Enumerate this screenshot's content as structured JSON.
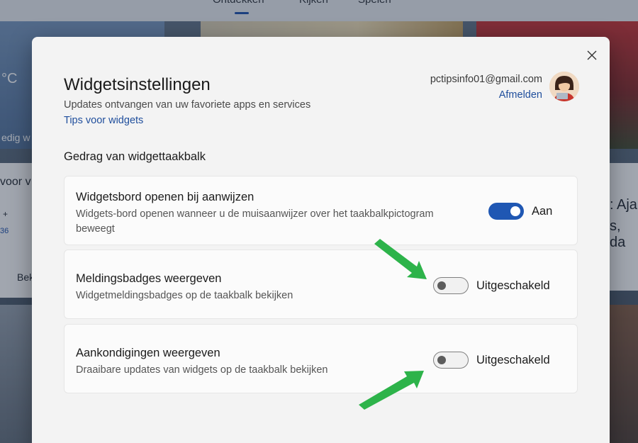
{
  "background": {
    "tabs": [
      "Ontdekken",
      "Kijken",
      "Spelen"
    ],
    "fragments": {
      "temp": "°C",
      "weather_hint": "edig w",
      "left_heading": "voor v",
      "left_row_1": "+",
      "left_row_2": "36",
      "left_button": "Bek",
      "right_headline_1": ": Aja",
      "right_headline_2": "s, da"
    }
  },
  "dialog": {
    "title": "Widgetsinstellingen",
    "subtitle": "Updates ontvangen van uw favoriete apps en services",
    "tips_link": "Tips voor widgets",
    "account": {
      "email": "pctipsinfo01@gmail.com",
      "signout": "Afmelden"
    },
    "section_heading": "Gedrag van widgettaakbalk",
    "settings": [
      {
        "title": "Widgetsbord openen bij aanwijzen",
        "description": "Widgets-bord openen wanneer u de muisaanwijzer over het taakbalkpictogram beweegt",
        "state": "Aan",
        "enabled": true
      },
      {
        "title": "Meldingsbadges weergeven",
        "description": "Widgetmeldingsbadges op de taakbalk bekijken",
        "state": "Uitgeschakeld",
        "enabled": false
      },
      {
        "title": "Aankondigingen weergeven",
        "description": "Draaibare updates van widgets op de taakbalk bekijken",
        "state": "Uitgeschakeld",
        "enabled": false
      }
    ]
  },
  "colors": {
    "accent": "#1f57b3",
    "link": "#1f4e9c",
    "annotation_arrow": "#2db34a"
  },
  "icons": {
    "close": "close-icon",
    "avatar": "user-avatar-icon",
    "arrows": "annotation-arrow-icon"
  }
}
